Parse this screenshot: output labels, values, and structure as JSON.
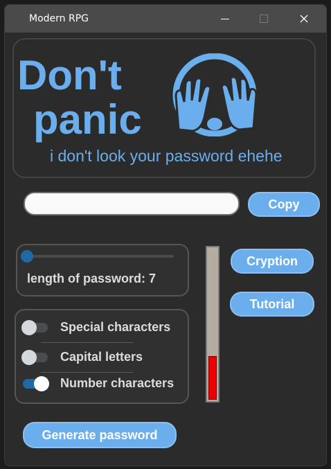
{
  "window": {
    "title": "Modern RPG"
  },
  "titlebar_icons": {
    "minimize": "minimize-icon",
    "maximize": "maximize-icon",
    "close": "close-icon"
  },
  "banner": {
    "line1": "Don't",
    "line2": "panic",
    "subtitle": "i don't look your password ehehe",
    "emoji": "face-with-hands-covering-eyes-icon"
  },
  "password": {
    "value": ""
  },
  "buttons": {
    "copy": "Copy",
    "cryption": "Cryption",
    "tutorial": "Tutorial",
    "generate": "Generate password"
  },
  "length": {
    "label": "length of password: 7",
    "value": 7,
    "slider_fraction": 0.0
  },
  "options": [
    {
      "label": "Special characters",
      "enabled": false
    },
    {
      "label": "Capital letters",
      "enabled": false
    },
    {
      "label": "Number characters",
      "enabled": true
    }
  ],
  "strength": {
    "fraction": 0.29,
    "color": "#ee0000"
  },
  "colors": {
    "accent": "#6aaeee",
    "slider": "#1f6aa5",
    "background": "#2b2b2b"
  }
}
